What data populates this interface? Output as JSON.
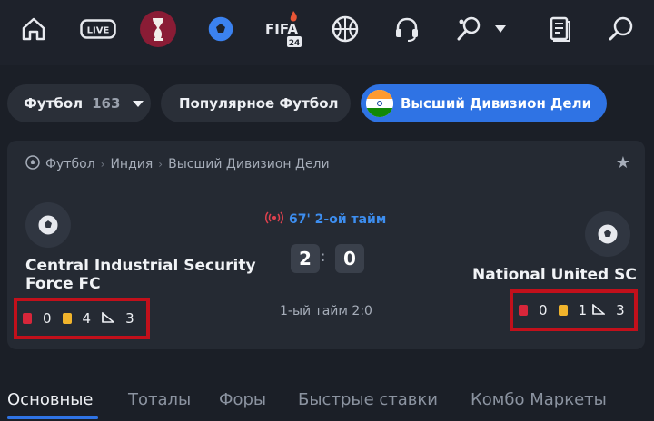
{
  "nav": {
    "icons": [
      "home-icon",
      "live-icon",
      "world-cup-icon",
      "soccer-ball-icon",
      "fifa24-icon",
      "basketball-icon",
      "headset-icon",
      "tennis-icon",
      "chevron-down-icon",
      "betslip-icon",
      "search-icon"
    ],
    "live_label": "LIVE",
    "fifa_label": "FIFA",
    "fifa_year": "24"
  },
  "chips": {
    "sport_label": "Футбол",
    "sport_count": "163",
    "popular_label": "Популярное Футбол",
    "league_label": "Высший Дивизион Дели"
  },
  "match": {
    "breadcrumb": [
      "Футбол",
      "Индия",
      "Высший Дивизион Дели"
    ],
    "status": "67' 2-ой тайм",
    "home": {
      "name_line1": "Central Industrial Security",
      "name_line2": "Force FC",
      "red_cards": "0",
      "yellow_cards": "4",
      "corners": "3"
    },
    "away": {
      "name": "National United SC",
      "red_cards": "0",
      "yellow_cards": "1",
      "corners": "3"
    },
    "score_home": "2",
    "score_away": "0",
    "score_separator": ":",
    "first_half": "1-ый тайм 2:0"
  },
  "tabs": [
    "Основные",
    "Тоталы",
    "Форы",
    "Быстрые ставки",
    "Комбо Маркеты"
  ],
  "colors": {
    "accent": "#2f73e4",
    "live": "#3d8ef0",
    "highlight_border": "#c2101b",
    "red_card": "#d8263a",
    "yellow_card": "#f1b42c"
  }
}
